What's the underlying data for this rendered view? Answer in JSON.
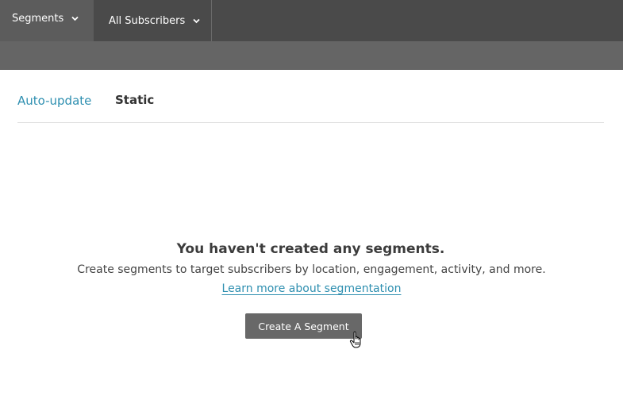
{
  "topbar": {
    "segments_label": "Segments",
    "audience_label": "All Subscribers",
    "chevron_icon": "chevron-down-icon"
  },
  "tabs": [
    {
      "label": "Auto-update",
      "active": true
    },
    {
      "label": "Static",
      "active": false
    }
  ],
  "empty_state": {
    "title": "You haven't created any segments.",
    "description": "Create segments to target subscribers by location, engagement, activity, and more.",
    "link": "Learn more about segmentation",
    "button": "Create A Segment"
  },
  "colors": {
    "accent": "#2e8fb0",
    "topbar": "#4a4a4a",
    "button": "#686868"
  },
  "cursor_icon": "hand-pointer-icon"
}
